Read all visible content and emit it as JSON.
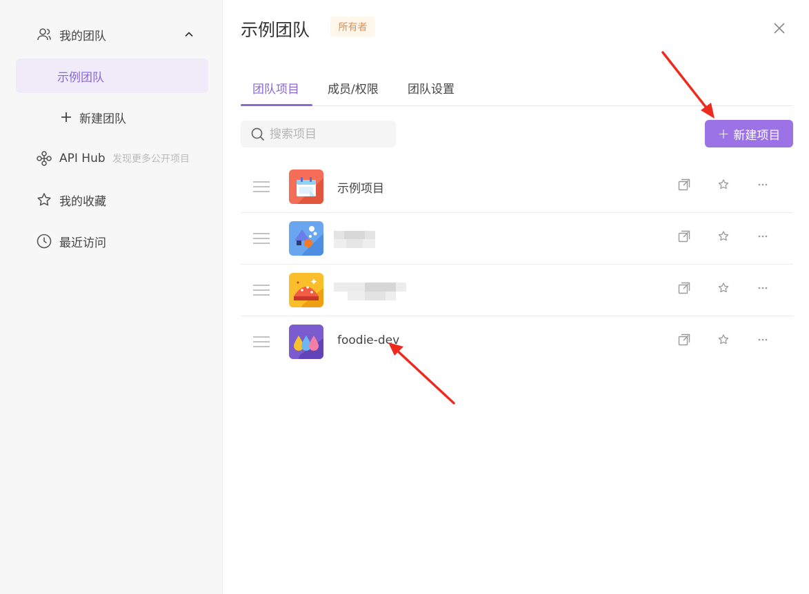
{
  "sidebar": {
    "my_team": "我的团队",
    "active_team": "示例团队",
    "new_team": "新建团队",
    "api_hub": "API Hub",
    "api_hub_sub": "发现更多公开项目",
    "favorites": "我的收藏",
    "recent": "最近访问"
  },
  "main": {
    "title": "示例团队",
    "badge": "所有者",
    "tabs": [
      {
        "label": "团队项目"
      },
      {
        "label": "成员/权限"
      },
      {
        "label": "团队设置"
      }
    ],
    "search": {
      "placeholder": "搜索项目"
    },
    "new_project_label": "新建项目",
    "new_project_icon": "plus-icon",
    "projects": [
      {
        "name": "示例项目",
        "icon": "calendar-icon",
        "color": "#f46d57"
      },
      {
        "name": "",
        "icon": "shapes-icon",
        "color": "#6aa5f0"
      },
      {
        "name": "",
        "icon": "pie-icon",
        "color": "#f9be2a"
      },
      {
        "name": "foodie-dev",
        "icon": "drops-icon",
        "color": "#7b5ccf"
      }
    ]
  },
  "colors": {
    "accent": "#8a66d9",
    "button": "#9b73e6",
    "badge_bg": "#fff6ec",
    "badge_text": "#d9925a",
    "annotation_arrow": "#ee2a1f"
  }
}
